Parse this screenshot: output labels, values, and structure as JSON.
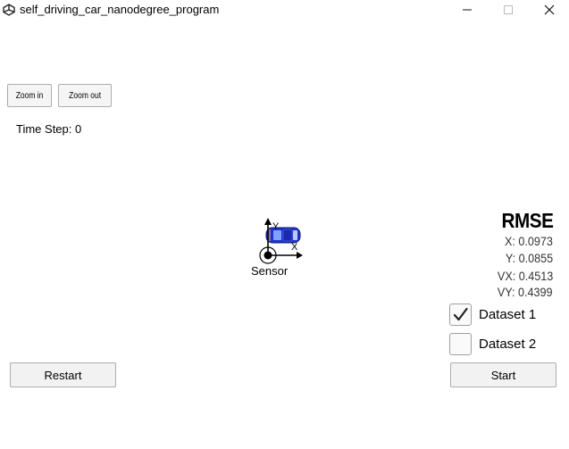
{
  "window": {
    "title": "self_driving_car_nanodegree_program",
    "controls": {
      "minimize": "minimize-icon",
      "maximize": "maximize-icon",
      "close": "close-icon"
    }
  },
  "toolbar": {
    "zoom_in_label": "Zoom in",
    "zoom_out_label": "Zoom out"
  },
  "status": {
    "time_step": "Time Step: 0"
  },
  "rmse": {
    "title": "RMSE",
    "x": "X: 0.0973",
    "y": "Y: 0.0855",
    "vx": "VX: 0.4513",
    "vy": "VY: 0.4399"
  },
  "datasets": [
    {
      "label": "Dataset 1",
      "checked": true
    },
    {
      "label": "Dataset 2",
      "checked": false
    }
  ],
  "scene": {
    "sensor_label": "Sensor",
    "x_axis_label": "X",
    "y_axis_label": "Y",
    "car_color": "#2233cc"
  },
  "buttons": {
    "restart_label": "Restart",
    "start_label": "Start"
  }
}
